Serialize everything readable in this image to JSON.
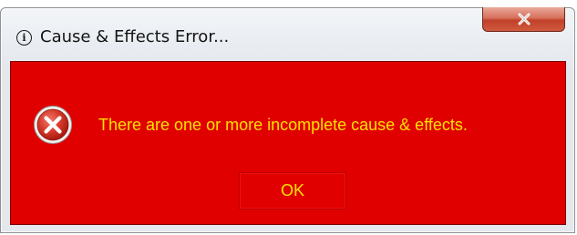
{
  "window": {
    "title": "Cause & Effects Error...",
    "title_icon": "info-icon",
    "close_icon": "close-icon"
  },
  "dialog": {
    "icon": "error-icon",
    "message": "There are one or more incomplete cause & effects.",
    "ok_label": "OK"
  },
  "colors": {
    "client_background": "#e00000",
    "text": "#ffe100",
    "close_button": "#c7452c"
  }
}
